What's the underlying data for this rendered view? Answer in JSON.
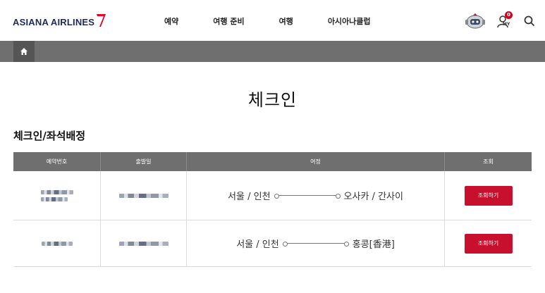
{
  "header": {
    "logo_text": "ASIANA AIRLINES",
    "nav": [
      "예약",
      "여행 준비",
      "여행",
      "아시아나클럽"
    ],
    "my_badge": "0",
    "my_label": "MY"
  },
  "breadcrumb": {
    "home_icon": "home-icon"
  },
  "page_title": "체크인",
  "section_title": "체크인/좌석배정",
  "table": {
    "headers": [
      "예약번호",
      "출발일",
      "여정",
      "조회"
    ],
    "rows": [
      {
        "from": "서울 / 인천",
        "to": "오사카 / 간사이",
        "button": "조회하기"
      },
      {
        "from": "서울 / 인천",
        "to": "홍콩[香港]",
        "button": "조회하기"
      }
    ]
  },
  "colors": {
    "accent": "#c8102e",
    "bar": "#6f6f6f",
    "brand_navy": "#1a2a5c"
  }
}
